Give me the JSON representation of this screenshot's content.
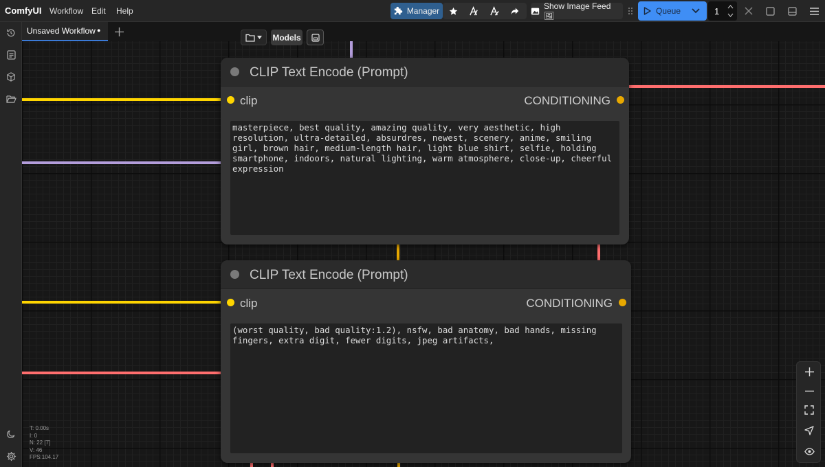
{
  "topbar": {
    "brand": "ComfyUI",
    "menu": [
      "Workflow",
      "Edit",
      "Help"
    ],
    "manager_label": "Manager",
    "image_feed_label": "Show Image Feed 🖼",
    "queue_label": "Queue",
    "queue_count": "1"
  },
  "tabs": {
    "active_tab": "Unsaved Workflow",
    "modified_marker": "●"
  },
  "canvas_toolbar": {
    "models_label": "Models"
  },
  "nodes": [
    {
      "title": "CLIP Text Encode (Prompt)",
      "input_label": "clip",
      "output_label": "CONDITIONING",
      "text": "masterpiece, best quality, amazing quality, very aesthetic, high resolution, ultra-detailed, absurdres, newest, scenery, anime, smiling girl, brown hair, medium-length hair, light blue shirt, selfie, holding smartphone, indoors, natural lighting, warm atmosphere, close-up, cheerful expression"
    },
    {
      "title": "CLIP Text Encode (Prompt)",
      "input_label": "clip",
      "output_label": "CONDITIONING",
      "text": "(worst quality, bad quality:1.2), nsfw, bad anatomy, bad hands, missing fingers, extra digit, fewer digits, jpeg artifacts,"
    }
  ],
  "stats": {
    "t": "T: 0.00s",
    "i": "I: 0",
    "n": "N: 22 [7]",
    "v": "V: 46",
    "fps": "FPS:104.17"
  },
  "colors": {
    "clip_wire": "#ffd500",
    "conditioning_wire": "#ff6e6e",
    "model_wire": "#b39ddb",
    "accent": "#3b7bd8"
  }
}
